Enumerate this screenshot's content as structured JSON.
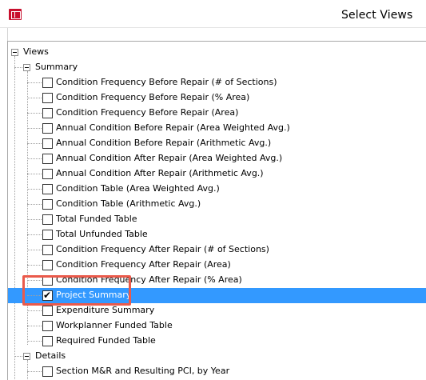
{
  "window": {
    "title": "Select Views",
    "icon": "app-logo-icon"
  },
  "tree": {
    "root": {
      "label": "Views",
      "expanded": true
    },
    "groups": [
      {
        "label": "Summary",
        "expanded": true,
        "items": [
          {
            "label": "Condition Frequency Before Repair (# of Sections)",
            "checked": false,
            "selected": false
          },
          {
            "label": "Condition Frequency Before Repair (% Area)",
            "checked": false,
            "selected": false
          },
          {
            "label": "Condition Frequency Before Repair (Area)",
            "checked": false,
            "selected": false
          },
          {
            "label": "Annual Condition Before Repair (Area Weighted Avg.)",
            "checked": false,
            "selected": false
          },
          {
            "label": "Annual Condition Before Repair (Arithmetic Avg.)",
            "checked": false,
            "selected": false
          },
          {
            "label": "Annual Condition After Repair (Area Weighted Avg.)",
            "checked": false,
            "selected": false
          },
          {
            "label": "Annual Condition After Repair (Arithmetic Avg.)",
            "checked": false,
            "selected": false
          },
          {
            "label": "Condition Table (Area Weighted Avg.)",
            "checked": false,
            "selected": false
          },
          {
            "label": "Condition Table (Arithmetic Avg.)",
            "checked": false,
            "selected": false
          },
          {
            "label": "Total Funded Table",
            "checked": false,
            "selected": false
          },
          {
            "label": "Total Unfunded Table",
            "checked": false,
            "selected": false
          },
          {
            "label": "Condition Frequency After Repair (# of Sections)",
            "checked": false,
            "selected": false
          },
          {
            "label": "Condition Frequency After Repair (Area)",
            "checked": false,
            "selected": false
          },
          {
            "label": "Condition Frequency After Repair (% Area)",
            "checked": false,
            "selected": false
          },
          {
            "label": "Project Summary",
            "checked": true,
            "selected": true
          },
          {
            "label": "Expenditure Summary",
            "checked": false,
            "selected": false
          },
          {
            "label": "Workplanner Funded Table",
            "checked": false,
            "selected": false
          },
          {
            "label": "Required Funded Table",
            "checked": false,
            "selected": false
          }
        ]
      },
      {
        "label": "Details",
        "expanded": true,
        "items": [
          {
            "label": "Section M&R and Resulting PCI, by Year",
            "checked": false,
            "selected": false
          }
        ]
      }
    ]
  },
  "colors": {
    "selection": "#3399ff",
    "highlight_annotation": "#ea5a4b",
    "app_icon": "#c8102e"
  }
}
